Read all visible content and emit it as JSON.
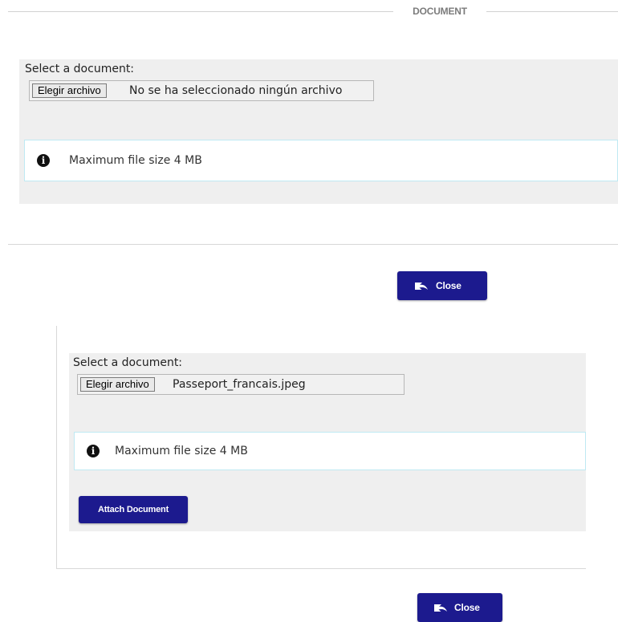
{
  "fieldset": {
    "legend": "DOCUMENT"
  },
  "upload_empty": {
    "label": "Select a document:",
    "file_button": "Elegir archivo",
    "file_status": "No se ha seleccionado ningún archivo",
    "info_icon": "info-circle-icon",
    "info_text": "Maximum file size 4 MB"
  },
  "close_1": {
    "icon": "undo-arrow-icon",
    "label": "Close"
  },
  "upload_selected": {
    "label": "Select a document:",
    "file_button": "Elegir archivo",
    "file_status": "Passeport_francais.jpeg",
    "info_icon": "info-circle-icon",
    "info_text": "Maximum file size 4 MB",
    "attach_button": "Attach Document"
  },
  "close_2": {
    "icon": "undo-arrow-icon",
    "label": "Close"
  },
  "colors": {
    "button_bg": "#1c1a8e",
    "panel_bg": "#efefef",
    "info_border": "#bfe9f3",
    "legend_text": "#7b7b7b"
  }
}
